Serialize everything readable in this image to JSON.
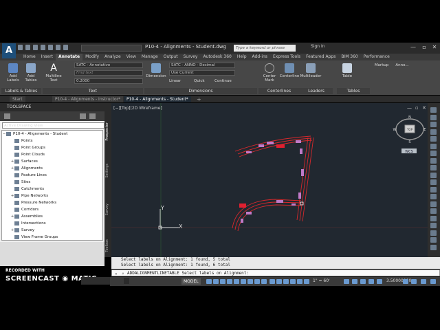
{
  "app": {
    "logo_letter": "A",
    "workspace": "",
    "window_title": "P10-4 - Alignments - Student.dwg",
    "search_placeholder": "Type a keyword or phrase",
    "sign_in": "Sign In"
  },
  "menu_tabs": [
    "Home",
    "Insert",
    "Annotate",
    "Modify",
    "Analyze",
    "View",
    "Manage",
    "Output",
    "Survey",
    "Autodesk 360",
    "Help",
    "Add-ins",
    "Express Tools",
    "Featured Apps",
    "BIM 360",
    "Performance"
  ],
  "ribbon": {
    "labels_tables": {
      "btn1": "Add Labels",
      "btn2": "Add Tables",
      "panel": "Labels & Tables"
    },
    "text": {
      "multiline": "Multiline Text",
      "style": "SATC - Annotative",
      "find": "Find text",
      "height": "0.2000",
      "panel": "Text"
    },
    "dimensions": {
      "dimension": "Dimension",
      "style": "SATC - ANNO - Decimal",
      "layer": "Use Current",
      "linear": "Linear",
      "quick": "Quick",
      "continue": "Continue",
      "panel": "Dimensions"
    },
    "centerlines": {
      "center_mark": "Center Mark",
      "centerline": "Centerline",
      "panel": "Centerlines"
    },
    "leaders": {
      "multileader": "Multileader",
      "panel": "Leaders"
    },
    "tables": {
      "table": "Table",
      "panel": "Tables"
    },
    "markup": "Markup",
    "anno": "Anno..."
  },
  "file_tabs": [
    "Start",
    "P10-4 - Alignments - Instructor*",
    "P10-4 - Alignments - Student*"
  ],
  "toolspace": {
    "title": "TOOLSPACE",
    "view": "Active Drawing View",
    "tree_root": "P10-4 - Alignments - Student",
    "items": [
      {
        "label": "Points",
        "exp": ""
      },
      {
        "label": "Point Groups",
        "exp": ""
      },
      {
        "label": "Point Clouds",
        "exp": ""
      },
      {
        "label": "Surfaces",
        "exp": "+"
      },
      {
        "label": "Alignments",
        "exp": "+"
      },
      {
        "label": "Feature Lines",
        "exp": ""
      },
      {
        "label": "Sites",
        "exp": ""
      },
      {
        "label": "Catchments",
        "exp": ""
      },
      {
        "label": "Pipe Networks",
        "exp": "+"
      },
      {
        "label": "Pressure Networks",
        "exp": ""
      },
      {
        "label": "Corridors",
        "exp": ""
      },
      {
        "label": "Assemblies",
        "exp": "+"
      },
      {
        "label": "Intersections",
        "exp": ""
      },
      {
        "label": "Survey",
        "exp": "+"
      },
      {
        "label": "View Frame Groups",
        "exp": ""
      }
    ],
    "vertical_tabs": [
      "Prospector",
      "Settings",
      "Survey",
      "Toolbox"
    ]
  },
  "viewport": {
    "label": "[−][Top][2D Wireframe]",
    "viewcube_face": "TOP",
    "compass": {
      "n": "N",
      "s": "S",
      "e": "E",
      "w": "W"
    },
    "wcs": "WCS",
    "ucs_x": "X",
    "ucs_y": "Y"
  },
  "command": {
    "history": [
      "Select labels on Alignment: 1 found, 5 total",
      "Select labels on Alignment: 1 found, 6 total"
    ],
    "current": "ADDALIGNMENTLINETABLE Select labels on Alignment:"
  },
  "status": {
    "model": "MODEL",
    "scale": "1\" = 60'",
    "coord": "3.50000000"
  },
  "overlay": {
    "recorded": "RECORDED WITH",
    "watermark": "SCREENCAST ◉ MATIC"
  }
}
